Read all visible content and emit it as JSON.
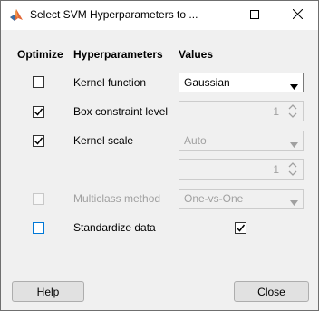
{
  "window": {
    "title": "Select SVM Hyperparameters to ..."
  },
  "headers": {
    "optimize": "Optimize",
    "hyperparameters": "Hyperparameters",
    "values": "Values"
  },
  "rows": {
    "kernel_function": {
      "label": "Kernel function",
      "optimize_checked": false,
      "value": "Gaussian"
    },
    "box_constraint": {
      "label": "Box constraint level",
      "optimize_checked": true,
      "value": "1"
    },
    "kernel_scale": {
      "label": "Kernel scale",
      "optimize_checked": true,
      "mode_value": "Auto",
      "value": "1"
    },
    "multiclass": {
      "label": "Multiclass method",
      "optimize_checked": false,
      "value": "One-vs-One"
    },
    "standardize": {
      "label": "Standardize data",
      "optimize_checked": false,
      "value_checked": true
    }
  },
  "buttons": {
    "help": "Help",
    "close": "Close"
  },
  "icons": {
    "app": "matlab-icon",
    "minimize": "minimize-icon",
    "maximize": "maximize-icon",
    "close": "close-icon"
  },
  "colors": {
    "focus_border": "#0078d7",
    "disabled_text": "#a0a0a0"
  }
}
